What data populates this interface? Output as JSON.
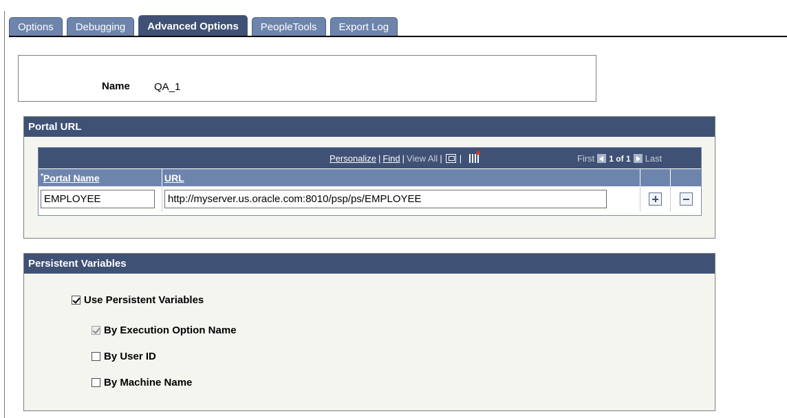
{
  "tabs": [
    {
      "label": "Options",
      "active": false
    },
    {
      "label": "Debugging",
      "active": false
    },
    {
      "label": "Advanced Options",
      "active": true
    },
    {
      "label": "PeopleTools",
      "active": false
    },
    {
      "label": "Export Log",
      "active": false
    }
  ],
  "name_field": {
    "label": "Name",
    "value": "QA_1"
  },
  "portal_url": {
    "title": "Portal URL",
    "grid_nav": {
      "personalize": "Personalize",
      "find": "Find",
      "view_all": "View All",
      "first": "First",
      "count": "1 of 1",
      "last": "Last"
    },
    "columns": {
      "required_mark": "*",
      "portal_name": "Portal Name",
      "url": "URL"
    },
    "rows": [
      {
        "portal_name": "EMPLOYEE",
        "url": "http://myserver.us.oracle.com:8010/psp/ps/EMPLOYEE"
      }
    ]
  },
  "persistent_variables": {
    "title": "Persistent Variables",
    "use": {
      "label": "Use Persistent Variables",
      "checked": true
    },
    "options": [
      {
        "label": "By Execution Option Name",
        "checked": true,
        "disabled": true
      },
      {
        "label": "By User ID",
        "checked": false,
        "disabled": false
      },
      {
        "label": "By Machine Name",
        "checked": false,
        "disabled": false
      }
    ]
  },
  "colors": {
    "header": "#3f5175",
    "tab": "#6d84ac",
    "panel": "#f4f5ef"
  }
}
